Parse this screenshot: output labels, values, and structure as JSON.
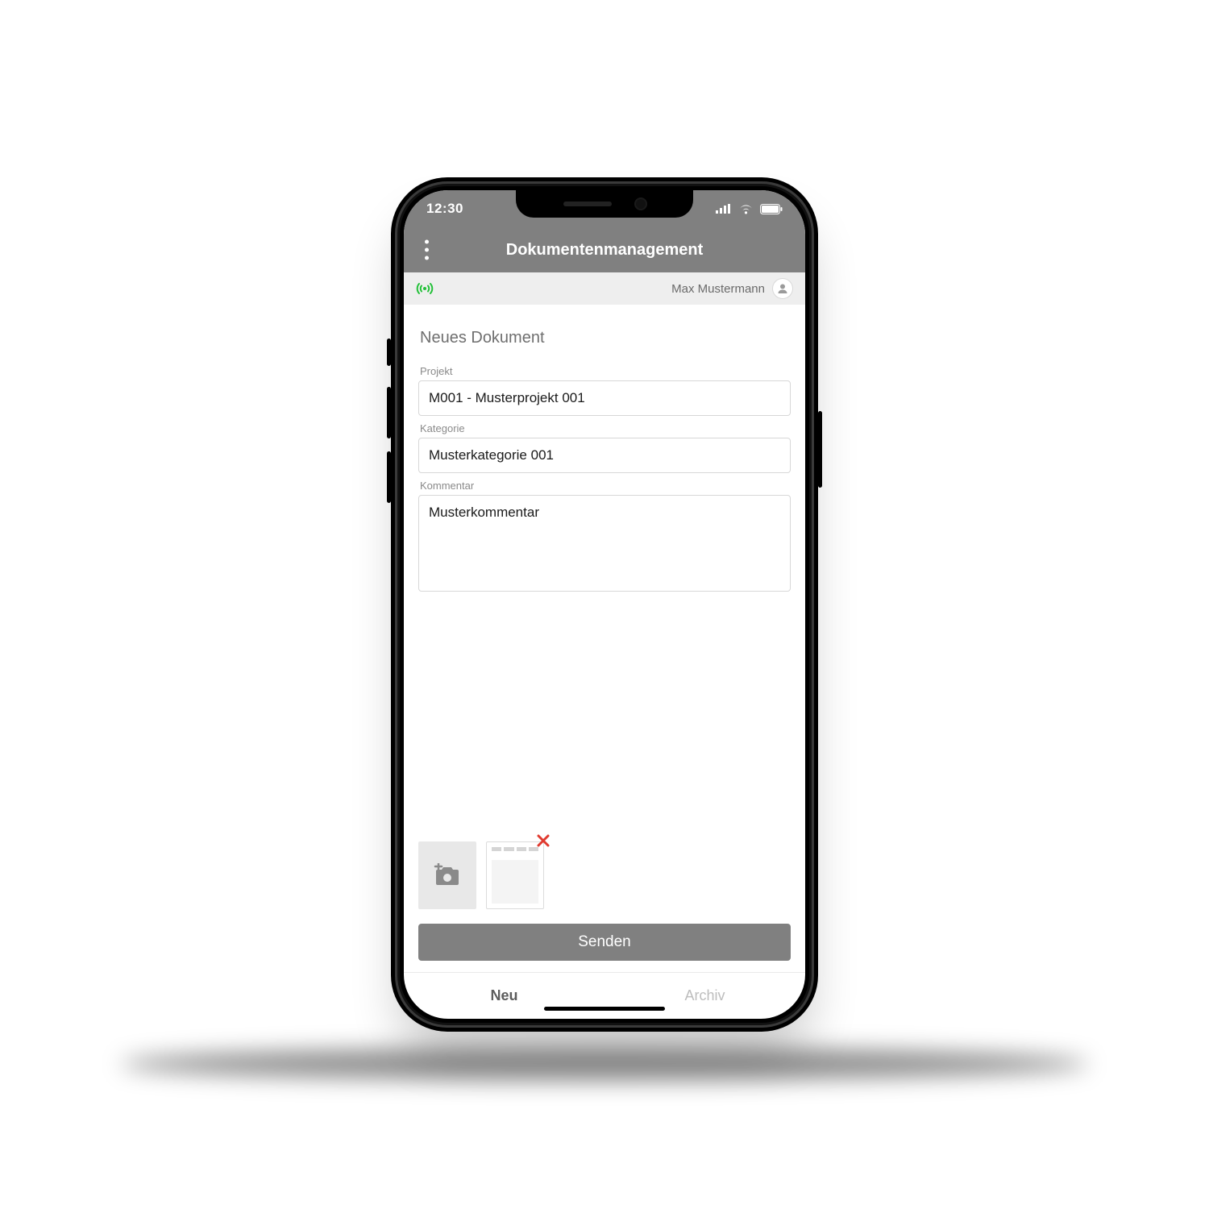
{
  "status": {
    "time": "12:30"
  },
  "header": {
    "title": "Dokumentenmanagement"
  },
  "substrip": {
    "user_name": "Max Mustermann"
  },
  "form": {
    "section_title": "Neues Dokument",
    "project_label": "Projekt",
    "project_value": "M001 - Musterprojekt 001",
    "category_label": "Kategorie",
    "category_value": "Musterkategorie 001",
    "comment_label": "Kommentar",
    "comment_value": "Musterkommentar"
  },
  "actions": {
    "send_label": "Senden"
  },
  "tabs": {
    "new_label": "Neu",
    "archive_label": "Archiv"
  },
  "colors": {
    "accent_green": "#22c038",
    "warn_red": "#e03a2f",
    "header_grey": "#808080"
  }
}
